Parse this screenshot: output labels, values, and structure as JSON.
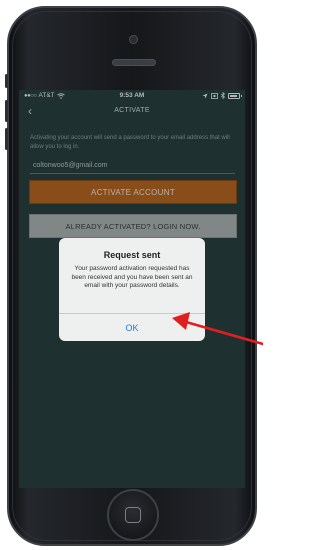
{
  "status_bar": {
    "signal": "●●○○",
    "carrier": "AT&T",
    "time": "9:53 AM",
    "battery_level": 0.9
  },
  "nav": {
    "title": "ACTIVATE",
    "back_glyph": "‹"
  },
  "activate_form": {
    "info_text": "Activating your account will send a password to your email address that will allow you to log in.",
    "email_value": "coltonwoo5@gmail.com",
    "activate_button_label": "ACTIVATE ACCOUNT",
    "login_button_label": "ALREADY ACTIVATED? LOGIN NOW."
  },
  "alert": {
    "title": "Request sent",
    "message": "Your password activation requested has been received and you have been sent an email with your password details.",
    "ok_label": "OK"
  },
  "colors": {
    "screen_bg": "#243a3a",
    "activate_button": "#b3601c",
    "login_button": "#a8acac",
    "ok_link": "#1a7ee6",
    "annotation_arrow": "#e02020"
  },
  "icons": {
    "back": "chevron-left-icon",
    "wifi": "wifi-icon",
    "location": "location-arrow-icon",
    "bluetooth": "bluetooth-icon",
    "battery": "battery-icon",
    "annotation": "red-arrow-icon"
  }
}
